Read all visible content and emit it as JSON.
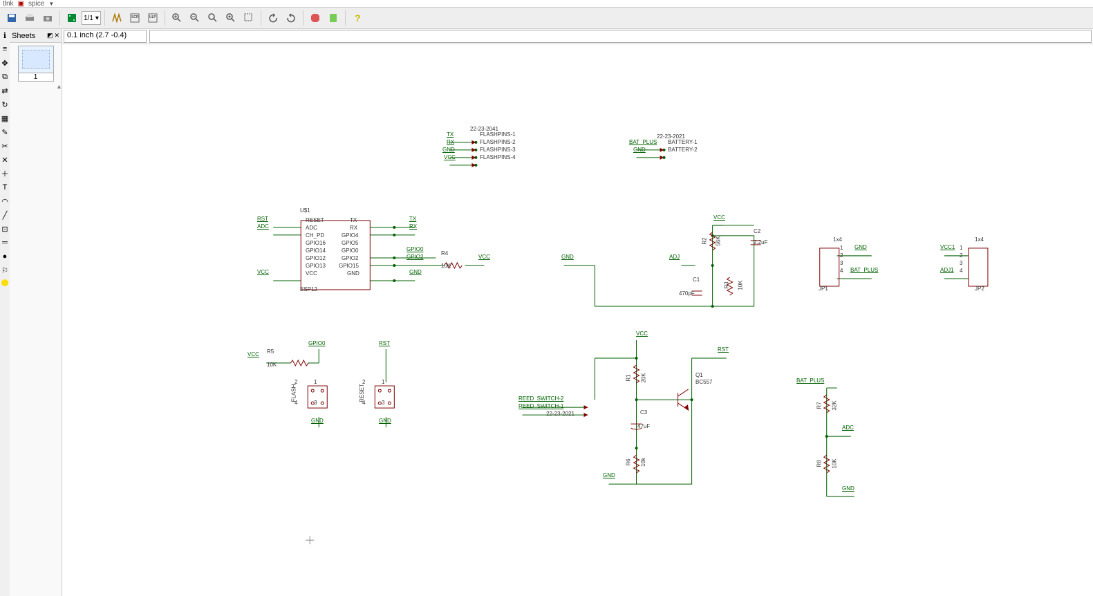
{
  "menu": {
    "item1": "tlnk",
    "item2": "spice"
  },
  "sheets_label": "Sheets",
  "page_indicator": "1/1",
  "thumb_num": "1",
  "coord": "0.1 inch (2.7 -0.4)",
  "cmdline": "",
  "flashheader": "22-23-2041",
  "flash": [
    {
      "sig": "TX",
      "pin": "FLASHPINS-1"
    },
    {
      "sig": "RX",
      "pin": "FLASHPINS-2"
    },
    {
      "sig": "GND",
      "pin": "FLASHPINS-3"
    },
    {
      "sig": "VCC",
      "pin": "FLASHPINS-4"
    }
  ],
  "battheader": "22-23-2021",
  "batt": [
    {
      "sig": "BAT_PLUS",
      "pin": "BATTERY-1"
    },
    {
      "sig": "GND",
      "pin": "BATTERY-2"
    }
  ],
  "ic": {
    "ref": "U$1",
    "name": "ESP12",
    "left": [
      "RESET",
      "ADC",
      "CH_PD",
      "GPIO16",
      "GPIO14",
      "GPIO12",
      "GPIO13",
      "VCC"
    ],
    "right": [
      "TX",
      "RX",
      "GPIO4",
      "GPIO5",
      "GPIO0",
      "GPIO2",
      "GPIO15",
      "GND"
    ],
    "lsig": [
      "RST",
      "ADC",
      "",
      "",
      "",
      "",
      "",
      "VCC"
    ],
    "rsig": [
      "TX",
      "RX",
      "",
      "",
      "GPIO0",
      "GPIO2",
      "",
      "GND"
    ]
  },
  "r4": {
    "ref": "R4",
    "val": "10K",
    "net1": "",
    "net2": "VCC"
  },
  "reg": {
    "top": "VCC",
    "topr": "C2",
    "toprval": "2.2uF",
    "r2": "R2",
    "r2val": "56K",
    "adj": "ADJ",
    "gnd": "GND",
    "c1": "C1",
    "c1val": "470pF",
    "r3": "R3",
    "r3val": "10K"
  },
  "jp1": {
    "ref": "JP1",
    "type": "1x4",
    "pins": [
      "1",
      "2",
      "3",
      "4"
    ],
    "net1": "GND",
    "net4": "BAT_PLUS"
  },
  "jp2": {
    "ref": "JP2",
    "type": "1x4",
    "pins": [
      "1",
      "2",
      "3",
      "4"
    ],
    "net1": "VCC1",
    "net4": "ADJ1"
  },
  "flashbtn": {
    "net_top": "GPIO0",
    "ref": "R5",
    "val": "10K",
    "vcc": "VCC",
    "sw": "FLASH",
    "gnd": "GND",
    "p": [
      "2",
      "1",
      "4",
      "3"
    ]
  },
  "rstbtn": {
    "net_top": "RST",
    "sw": "RESET",
    "gnd": "GND",
    "p": [
      "2",
      "1",
      "4",
      "3"
    ]
  },
  "trans": {
    "vcc": "VCC",
    "r1": "R1",
    "r1val": "20K",
    "rst": "RST",
    "q": "Q1",
    "qval": "BC557",
    "reed1": "REED_SWITCH-2",
    "reed2": "REED_SWITCH-1",
    "reedref": "22-23-2021",
    "c3": "C3",
    "c3val": "47uF",
    "gnd": "GND",
    "r6": "R6",
    "r6val": "10k"
  },
  "adc": {
    "top": "BAT_PLUS",
    "r7": "R7",
    "r7val": "32K",
    "mid": "ADC",
    "r8": "R8",
    "r8val": "10K",
    "gnd": "GND"
  }
}
